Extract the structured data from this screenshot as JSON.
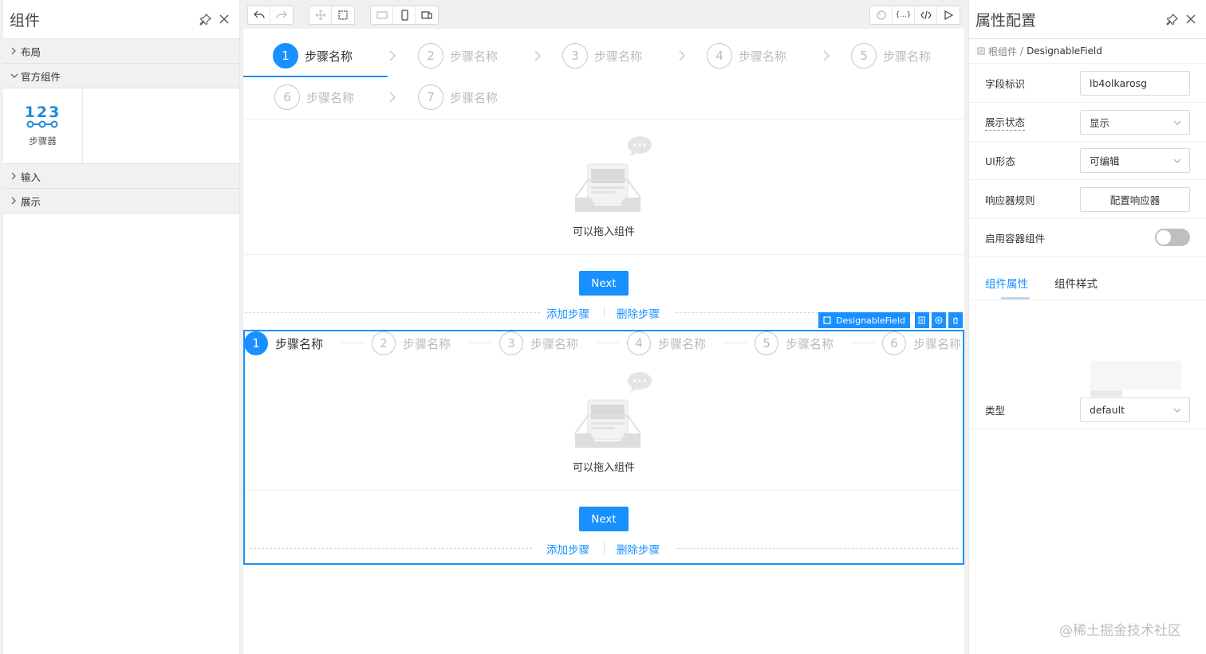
{
  "left_panel": {
    "title": "组件",
    "groups": {
      "layout": "布局",
      "official": "官方组件",
      "input": "输入",
      "display": "展示"
    },
    "widget": {
      "icon_text": "123",
      "label": "步骤器"
    }
  },
  "canvas": {
    "steps_top": [
      {
        "num": "1",
        "title": "步骤名称",
        "active": true
      },
      {
        "num": "2",
        "title": "步骤名称"
      },
      {
        "num": "3",
        "title": "步骤名称"
      },
      {
        "num": "4",
        "title": "步骤名称"
      },
      {
        "num": "5",
        "title": "步骤名称"
      },
      {
        "num": "6",
        "title": "步骤名称"
      },
      {
        "num": "7",
        "title": "步骤名称"
      }
    ],
    "drop_text": "可以拖入组件",
    "next_label": "Next",
    "add_step": "添加步骤",
    "delete_step": "删除步骤",
    "selected": {
      "tag": "DesignableField",
      "steps": [
        {
          "num": "1",
          "title": "步骤名称"
        },
        {
          "num": "2",
          "title": "步骤名称"
        },
        {
          "num": "3",
          "title": "步骤名称"
        },
        {
          "num": "4",
          "title": "步骤名称"
        },
        {
          "num": "5",
          "title": "步骤名称"
        },
        {
          "num": "6",
          "title": "步骤名称"
        }
      ]
    }
  },
  "right_panel": {
    "title": "属性配置",
    "breadcrumb": {
      "root": "根组件",
      "sep": "/",
      "current": "DesignableField"
    },
    "props": {
      "field_id": {
        "label": "字段标识",
        "value": "lb4olkarosg"
      },
      "display_state": {
        "label": "展示状态",
        "value": "显示"
      },
      "ui_state": {
        "label": "UI形态",
        "value": "可编辑"
      },
      "reactions": {
        "label": "响应器规则",
        "button": "配置响应器"
      },
      "container": {
        "label": "启用容器组件"
      },
      "type": {
        "label": "类型",
        "value": "default"
      }
    },
    "tabs": {
      "props": "组件属性",
      "style": "组件样式"
    }
  },
  "watermark": "@稀土掘金技术社区",
  "colors": {
    "accent": "#1890ff"
  }
}
